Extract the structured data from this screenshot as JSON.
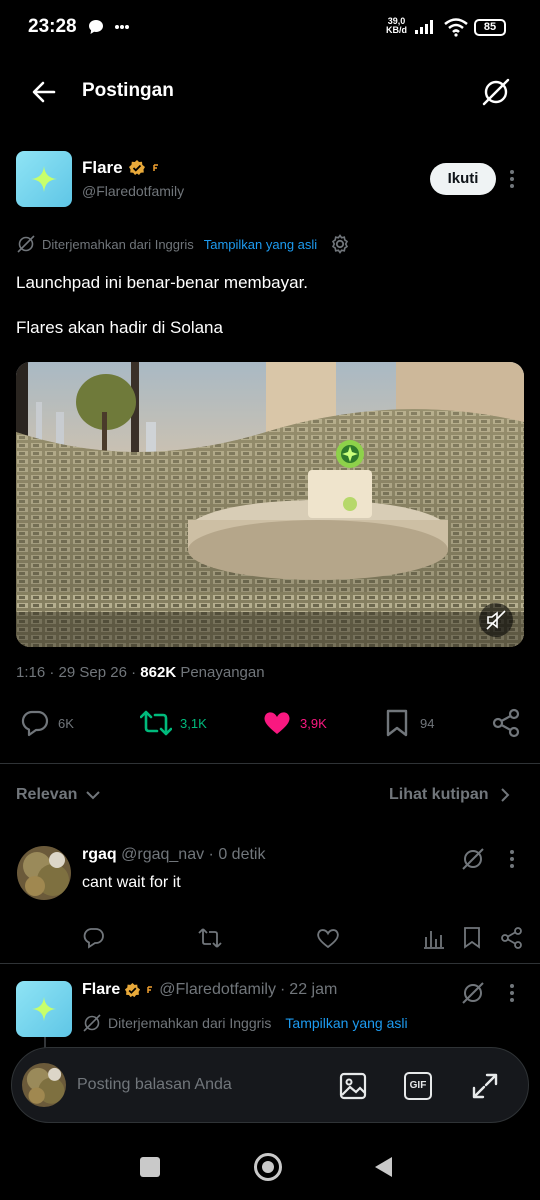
{
  "status_bar": {
    "time": "23:28",
    "net_speed": "39,0",
    "net_unit": "KB/d",
    "battery": "85"
  },
  "header": {
    "title": "Postingan",
    "back_icon": "arrow-left-icon",
    "grok_icon": "grok-icon"
  },
  "post": {
    "author_name": "Flare",
    "author_handle": "@Flaredotfamily",
    "follow_label": "Ikuti",
    "translated_label": "Diterjemahkan dari Inggris",
    "show_original_label": "Tampilkan yang asli",
    "text_line_1": "Launchpad ini benar-benar membayar.",
    "text_line_2": "Flares akan hadir di Solana",
    "time": "1:16",
    "date": "29 Sep 26",
    "views": "862K",
    "views_label": "Penayangan",
    "stats": {
      "replies": "6K",
      "reposts": "3,1K",
      "likes": "3,9K",
      "bookmarks": "94"
    }
  },
  "sort": {
    "relevan_label": "Relevan",
    "quotes_label": "Lihat kutipan"
  },
  "replies": [
    {
      "name": "rgaq",
      "handle": "@rgaq_nav",
      "time": "0 detik",
      "text": "cant wait for it"
    },
    {
      "name": "Flare",
      "handle": "@Flaredotfamily",
      "time": "22 jam",
      "translated_label": "Diterjemahkan dari Inggris",
      "show_original_label": "Tampilkan yang asli"
    }
  ],
  "composer": {
    "placeholder": "Posting balasan Anda",
    "gif_label": "GIF"
  },
  "colors": {
    "accent_blue": "#1d9bf0",
    "repost_green": "#00ba7c",
    "like_pink": "#f91880",
    "verified_gold": "#e8a93a"
  }
}
